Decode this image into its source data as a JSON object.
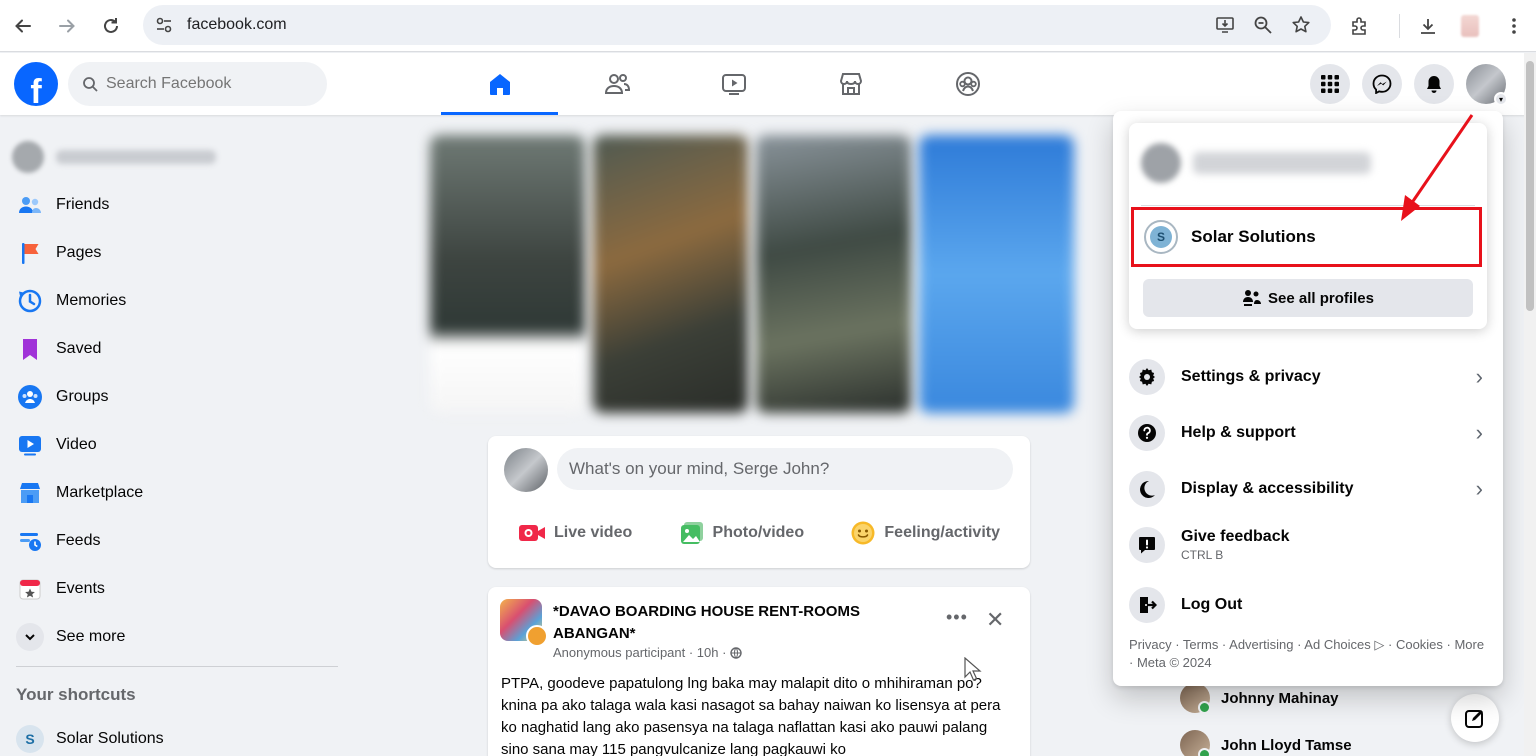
{
  "browser": {
    "url": "facebook.com"
  },
  "header": {
    "search_placeholder": "Search Facebook"
  },
  "sidebar": {
    "items": [
      {
        "label": "Friends",
        "icon": "friends-icon"
      },
      {
        "label": "Pages",
        "icon": "flag-icon"
      },
      {
        "label": "Memories",
        "icon": "clock-icon"
      },
      {
        "label": "Saved",
        "icon": "bookmark-icon"
      },
      {
        "label": "Groups",
        "icon": "groups-icon"
      },
      {
        "label": "Video",
        "icon": "video-icon"
      },
      {
        "label": "Marketplace",
        "icon": "store-icon"
      },
      {
        "label": "Feeds",
        "icon": "feeds-icon"
      },
      {
        "label": "Events",
        "icon": "calendar-icon"
      }
    ],
    "see_more": "See more",
    "shortcuts_heading": "Your shortcuts",
    "shortcut": {
      "label": "Solar Solutions",
      "initial": "S"
    }
  },
  "composer": {
    "placeholder": "What's on your mind, Serge John?",
    "actions": [
      "Live video",
      "Photo/video",
      "Feeling/activity"
    ]
  },
  "post": {
    "title": "*DAVAO BOARDING HOUSE RENT-ROOMS ABANGAN*",
    "meta": "Anonymous participant · 10h ·",
    "body": "PTPA, goodeve papatulong lng baka may malapit dito o mhihiraman po? knina pa ako talaga wala kasi nasagot sa bahay naiwan ko lisensya at pera ko naghatid lang ako pasensya na talaga naflattan kasi ako pauwi palang sino sana may 115 pangvulcanize lang pagkauwi ko"
  },
  "contacts": [
    "Johnny Mahinay",
    "John Lloyd Tamse"
  ],
  "dropdown": {
    "profile": {
      "label": "Solar Solutions",
      "initial": "S"
    },
    "see_all": "See all profiles",
    "items": [
      {
        "label": "Settings & privacy",
        "icon": "gear-icon"
      },
      {
        "label": "Help & support",
        "icon": "question-icon"
      },
      {
        "label": "Display & accessibility",
        "icon": "moon-icon"
      },
      {
        "label": "Give feedback",
        "sub": "CTRL B",
        "icon": "feedback-icon"
      },
      {
        "label": "Log Out",
        "icon": "logout-icon"
      }
    ],
    "footer": "Privacy · Terms · Advertising · Ad Choices ▷ · Cookies · More · Meta © 2024"
  },
  "colors": {
    "brand": "#0866ff",
    "annotation": "#e8111b"
  }
}
